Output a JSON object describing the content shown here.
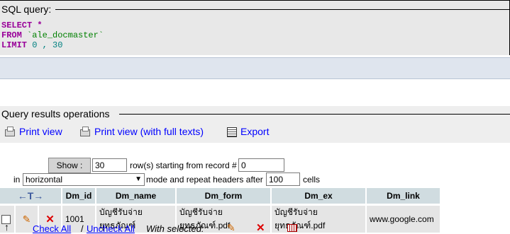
{
  "sql_box": {
    "legend": "SQL query:",
    "line1_kw": "SELECT",
    "line1_rest": "*",
    "line2_kw": "FROM",
    "line2_table": "`ale_docmaster`",
    "line3_kw": "LIMIT",
    "line3_a": "0",
    "line3_sep": ",",
    "line3_b": "30"
  },
  "operations": {
    "legend": "Query results operations",
    "print_view": "Print view",
    "print_view_full": "Print view (with full texts)",
    "export": "Export"
  },
  "navigation": {
    "show_button": "Show :",
    "rows_value": "30",
    "rows_text": "row(s) starting from record #",
    "start_value": "0",
    "in_text": "in",
    "mode_value": "horizontal",
    "mode_text": "mode and repeat headers after",
    "repeat_value": "100",
    "cells_text": "cells"
  },
  "table": {
    "columns": [
      "Dm_id",
      "Dm_name",
      "Dm_form",
      "Dm_ex",
      "Dm_link"
    ],
    "rows": [
      {
        "Dm_id": "1001",
        "Dm_name": "บัญชีรับจ่ายยุทธภัณฑ์",
        "Dm_form": "บัญชีรับจ่ายยุทธภัณฑ์.pdf",
        "Dm_ex": "บัญชีรับจ่ายยุทธภัณฑ์.pdf",
        "Dm_link": "www.google.com"
      }
    ]
  },
  "bottom": {
    "check_all": "Check All",
    "separator": "/",
    "uncheck_all": "Uncheck All",
    "with_selected": "With selected:"
  },
  "icons": {
    "print": "printer-icon",
    "export": "table-icon",
    "edit": "pencil-icon",
    "delete": "delete-icon",
    "sort": "arrows-icon"
  }
}
